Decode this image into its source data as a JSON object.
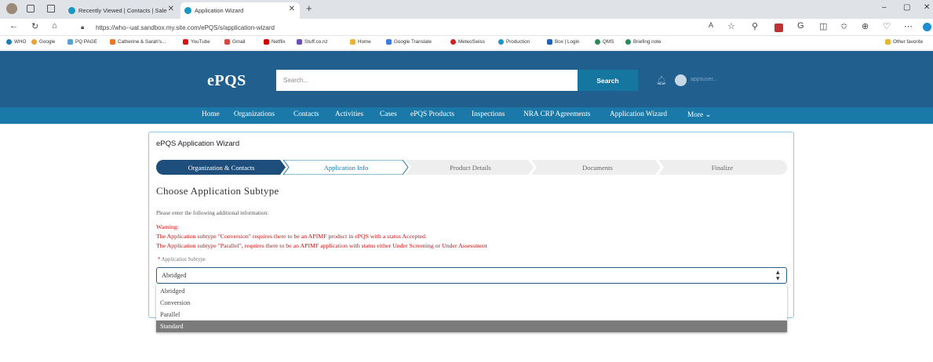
{
  "browser": {
    "tabs": [
      {
        "label": "Recently Viewed | Contacts | Sale"
      },
      {
        "label": "Application Wizard"
      }
    ],
    "new_tab": "+",
    "url": "https://who--uat.sandbox.my.site.com/ePQS/s/application-wizard",
    "bookmarks": [
      "WHO",
      "Google",
      "PQ PAGE",
      "Catherine & Sarah's...",
      "YouTube",
      "Gmail",
      "Netflix",
      "Stuff.co.nz",
      "Home",
      "Google Translate",
      "MeteoSwiss",
      "Production",
      "Box | Login",
      "QMS",
      "Briefing note"
    ],
    "other_favorites": "Other favorite",
    "window_controls": [
      "–",
      "▢",
      "✕"
    ]
  },
  "app": {
    "logo": "ePQS",
    "search": {
      "placeholder": "Search...",
      "button": "Search"
    },
    "user": "appsuser...",
    "nav": [
      "Home",
      "Organizations",
      "Contacts",
      "Activities",
      "Cases",
      "ePQS Products",
      "Inspections",
      "NRA CRP Agreements",
      "Application Wizard",
      "More"
    ]
  },
  "wizard": {
    "title": "ePQS Application Wizard",
    "steps": [
      "Organization & Contacts",
      "Application Info",
      "Product Details",
      "Documents",
      "Finalize"
    ],
    "heading": "Choose Application Subtype",
    "instruction": "Please enter the following additional information:",
    "warning_title": "Warning:",
    "warning_lines": [
      "The Application subtype \"Conversion\" requires there to be an APIMF product in ePQS with a status Accepted.",
      "The Application subtype \"Parallel\", requires there to be an APIMF application with status either Under Screening or Under Assessment"
    ],
    "field_label": "Application Subtype",
    "required_mark": "*",
    "selected_value": "Abridged",
    "options": [
      "Abridged",
      "Conversion",
      "Parallel",
      "Standard"
    ],
    "highlighted_option": "Standard"
  },
  "colors": {
    "header": "#215f8f",
    "nav": "#1a79a8",
    "step_active": "#1e4f7c",
    "warning": "#cc1111"
  }
}
